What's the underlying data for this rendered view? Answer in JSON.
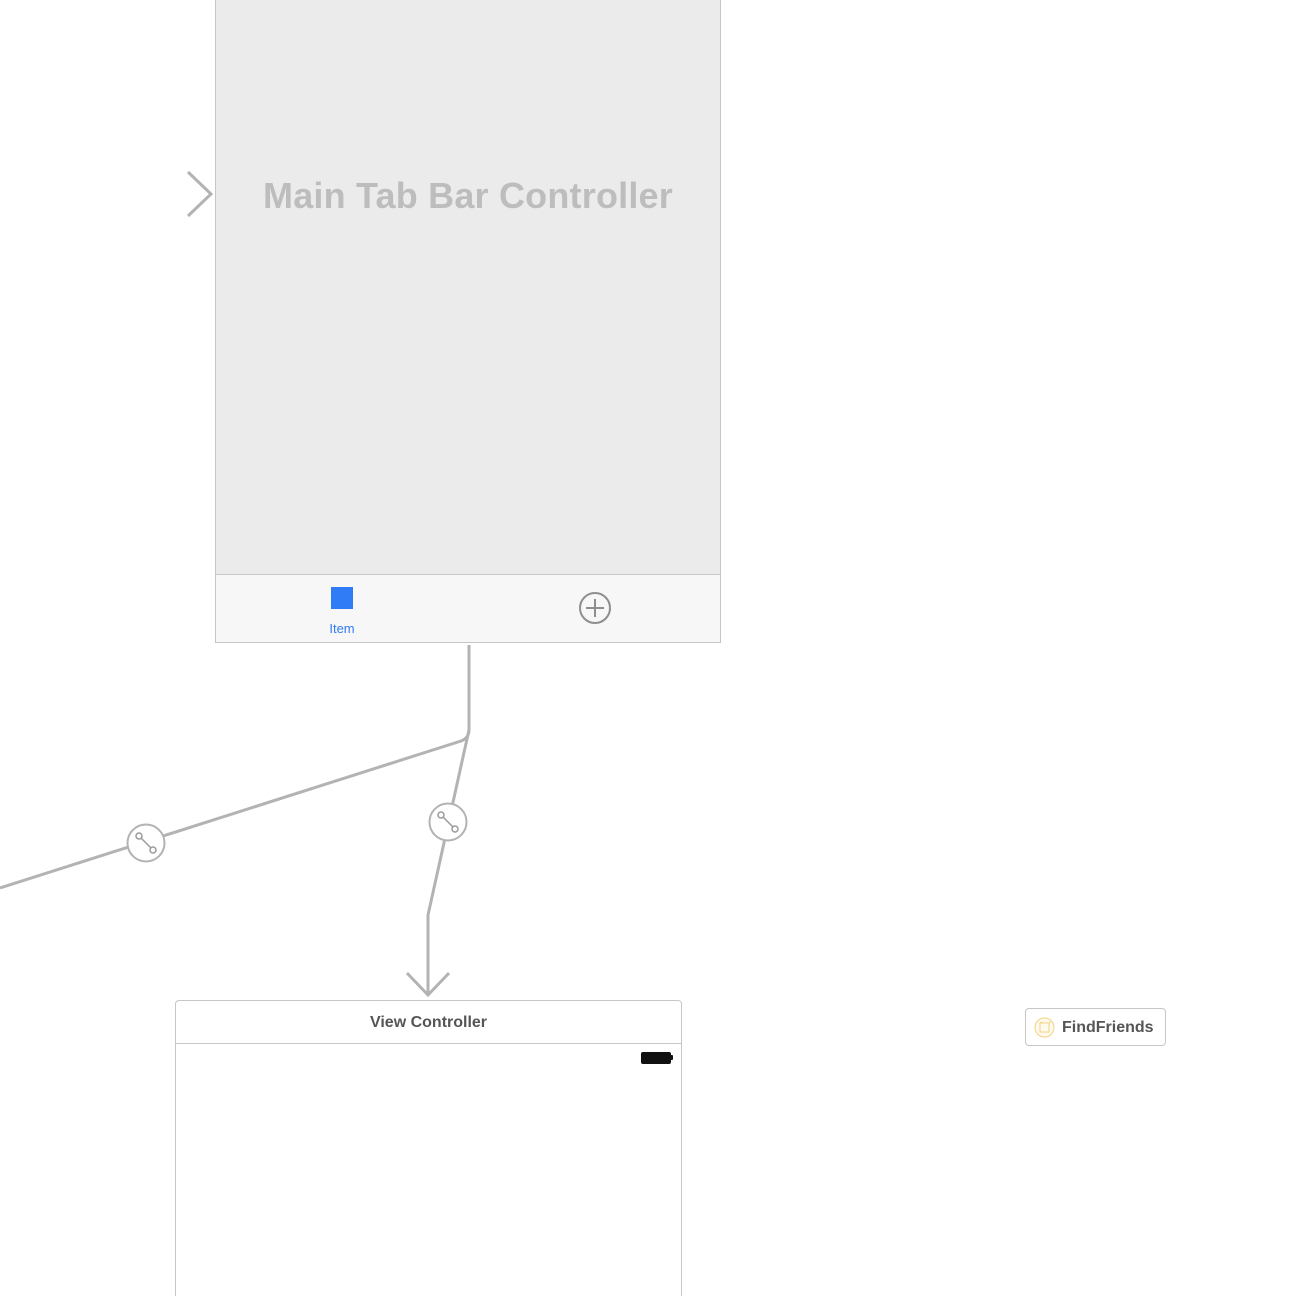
{
  "storyboard": {
    "tab_bar_controller": {
      "title": "Main Tab Bar Controller",
      "tab_items": [
        {
          "label": "Item",
          "icon": "square-icon",
          "selected": true,
          "color": "#2f7cf6"
        },
        {
          "label": "",
          "icon": "plus-circle-icon",
          "selected": false
        }
      ]
    },
    "view_controller": {
      "title": "View Controller",
      "status_bar_icon": "battery-icon"
    },
    "object_chip": {
      "label": "FindFriends",
      "icon": "object-cube-icon"
    },
    "segue_icon": "segue-relationship-icon",
    "entry_point_icon": "entry-point-arrow-icon"
  },
  "colors": {
    "accent": "#2f7cf6",
    "connector": "#b3b3b3",
    "scene_background": "#ebebeb",
    "border": "#c6c6c6"
  }
}
